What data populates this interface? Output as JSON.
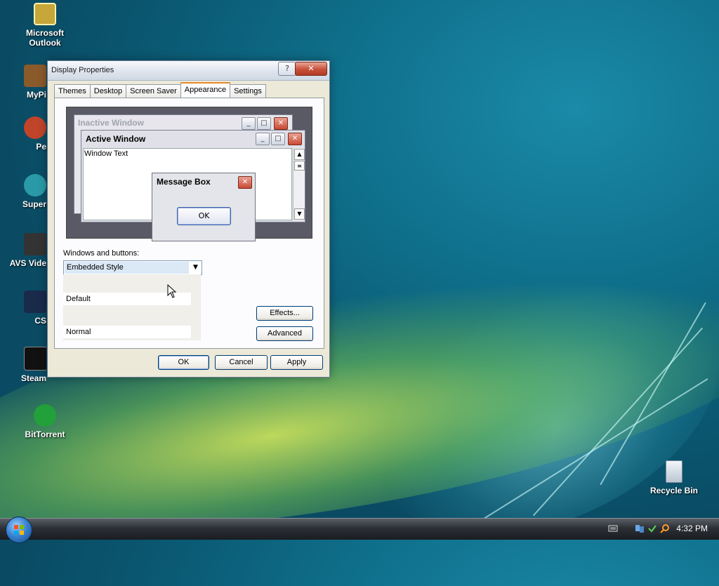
{
  "desktop": {
    "icons": [
      {
        "label": "Microsoft Outlook",
        "icon": "outlook-icon",
        "color": "#c7a63a"
      },
      {
        "label": "MyPi",
        "icon": "mypictures-icon",
        "color": "#8b5a2b"
      },
      {
        "label": "Pe",
        "icon": "app-icon",
        "color": "#c0442a"
      },
      {
        "label": "Super",
        "icon": "app-icon",
        "color": "#2a9aa8"
      },
      {
        "label": "AVS Vide",
        "icon": "film-icon",
        "color": "#333333"
      },
      {
        "label": "CS",
        "icon": "cs-icon",
        "color": "#1a2a4a"
      },
      {
        "label": "Steam",
        "icon": "steam-icon",
        "color": "#111111"
      },
      {
        "label": "BitTorrent",
        "icon": "bittorrent-icon",
        "color": "#22a03a"
      },
      {
        "label": "Recycle Bin",
        "icon": "recycle-bin-icon",
        "color": "#cfd8e0"
      }
    ]
  },
  "dialog": {
    "title": "Display Properties",
    "help_glyph": "?",
    "close_glyph": "✕",
    "tabs": [
      "Themes",
      "Desktop",
      "Screen Saver",
      "Appearance",
      "Settings"
    ],
    "active_tab": "Appearance",
    "preview": {
      "inactive_title": "Inactive Window",
      "active_title": "Active Window",
      "window_text": "Window Text",
      "msgbox_title": "Message Box",
      "msgbox_ok": "OK"
    },
    "windows_buttons_label": "Windows and buttons:",
    "windows_buttons_value": "Embedded Style",
    "color_scheme_value": "Default",
    "font_size_value": "Normal",
    "effects_label": "Effects...",
    "advanced_label": "Advanced",
    "ok_label": "OK",
    "cancel_label": "Cancel",
    "apply_label": "Apply"
  },
  "taskbar": {
    "clock": "4:32 PM"
  },
  "colors": {
    "accent": "#e68b2c",
    "selection": "#dbe8f6"
  }
}
